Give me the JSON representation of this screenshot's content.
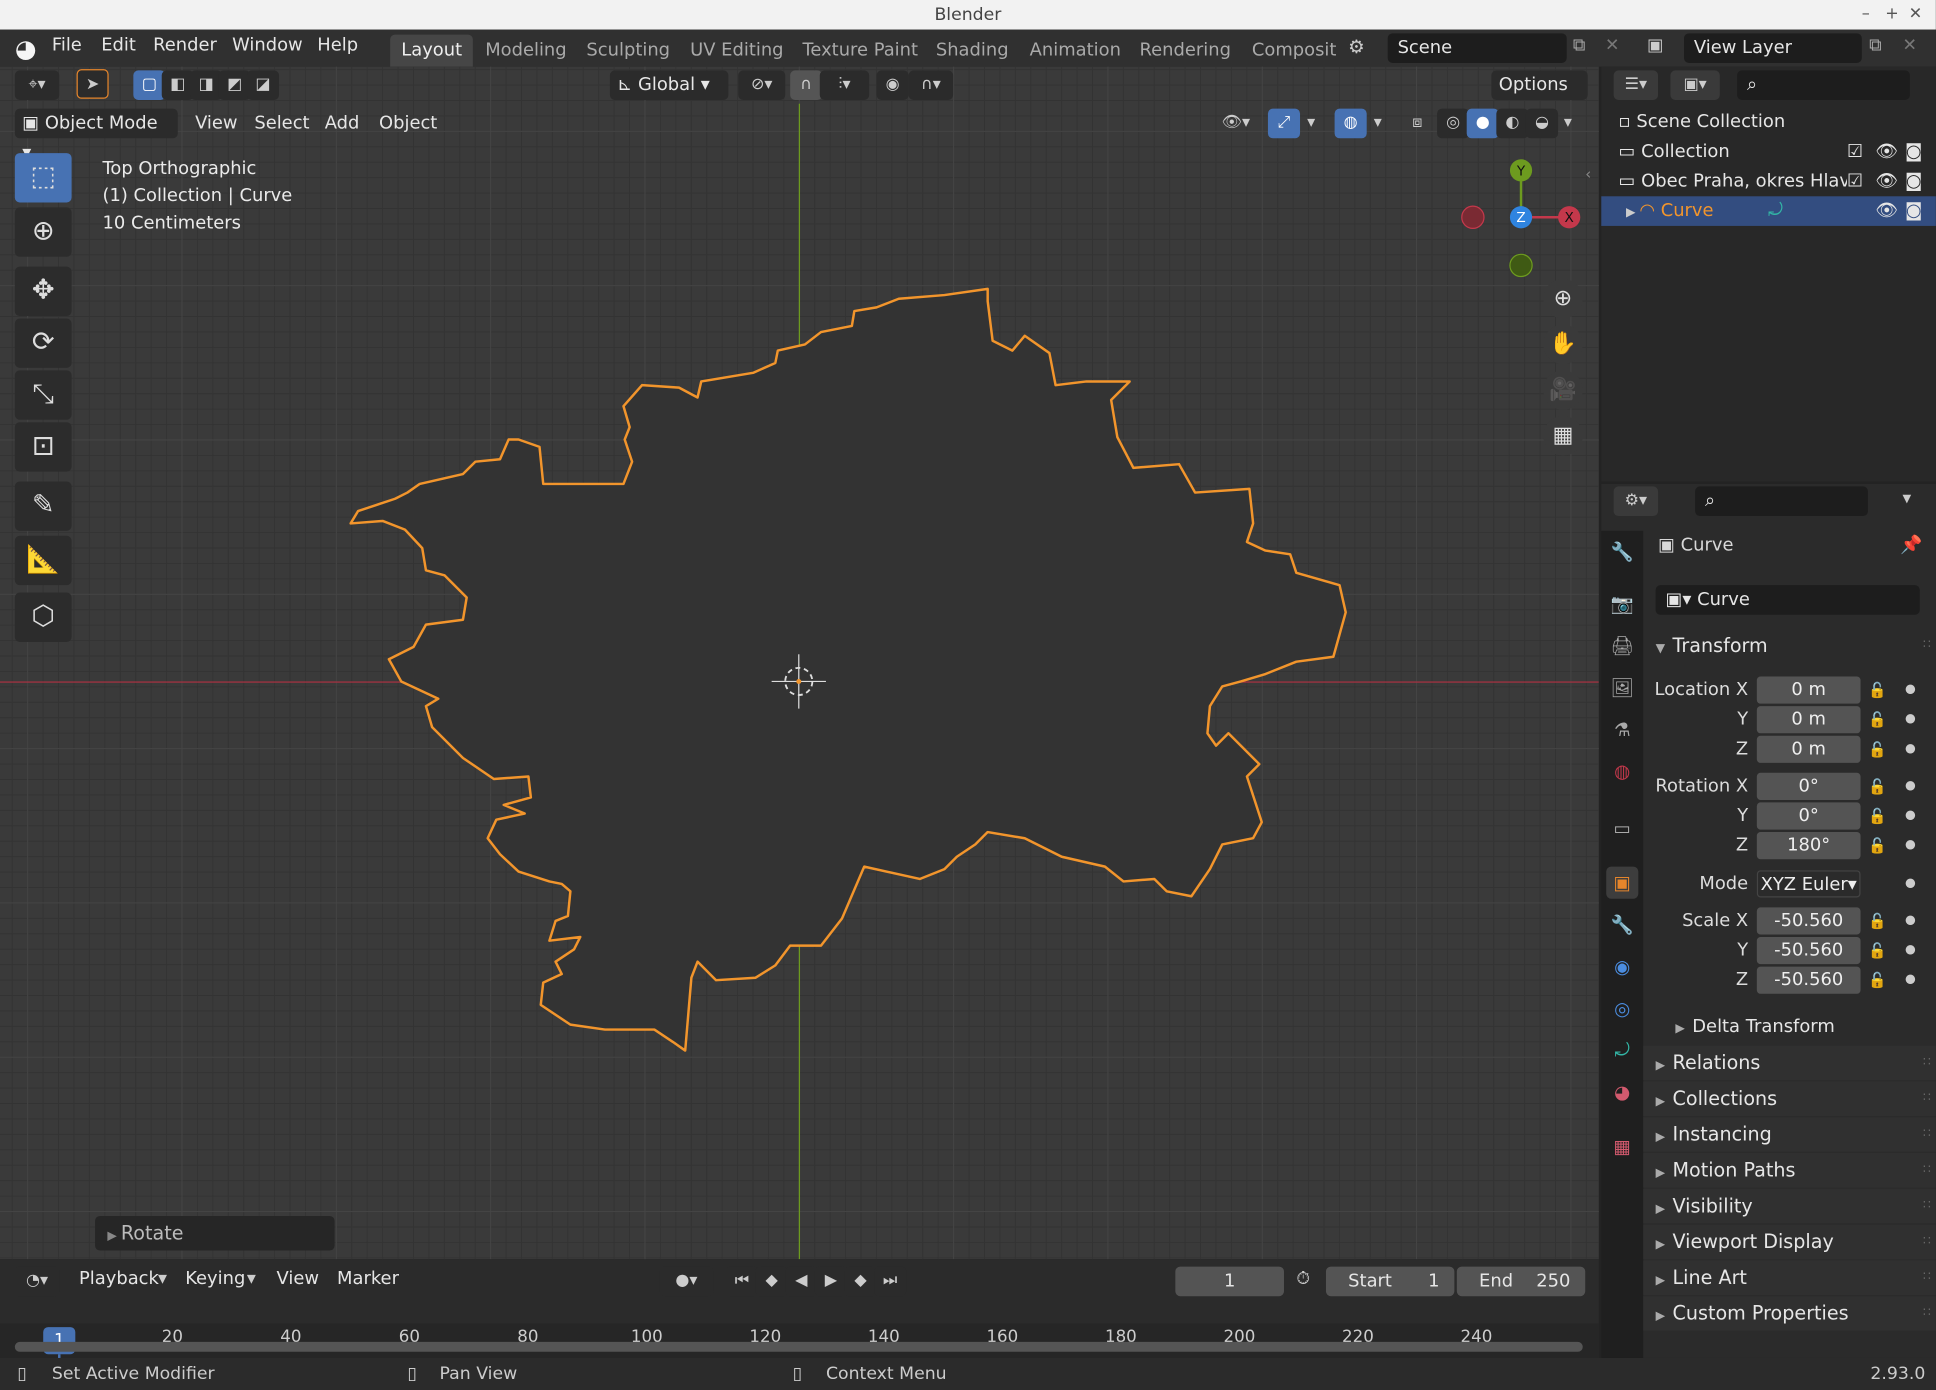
{
  "window": {
    "title": "Blender",
    "controls": [
      "–",
      "+",
      "✕"
    ]
  },
  "menus": [
    "File",
    "Edit",
    "Render",
    "Window",
    "Help"
  ],
  "workspaces": [
    "Layout",
    "Modeling",
    "Sculpting",
    "UV Editing",
    "Texture Paint",
    "Shading",
    "Animation",
    "Rendering",
    "Composit"
  ],
  "scene": {
    "name": "Scene",
    "view_layer": "View Layer"
  },
  "viewport": {
    "mode": "Object Mode",
    "menus": [
      "View",
      "Select",
      "Add",
      "Object"
    ],
    "orientation": "Global",
    "options": "Options",
    "info": [
      "Top Orthographic",
      "(1) Collection | Curve",
      "10 Centimeters"
    ],
    "gizmo_axes": [
      "Y",
      "Z",
      "X"
    ],
    "last_op": "Rotate"
  },
  "timeline": {
    "menus": [
      "Playback",
      "Keying",
      "View",
      "Marker"
    ],
    "current_frame": "1",
    "start_label": "Start",
    "start": "1",
    "end_label": "End",
    "end": "250",
    "ticks": [
      "20",
      "40",
      "60",
      "80",
      "100",
      "120",
      "140",
      "160",
      "180",
      "200",
      "220",
      "240"
    ]
  },
  "outliner": {
    "root": "Scene Collection",
    "items": [
      "Collection",
      "Obec Praha, okres Hlav",
      "Curve"
    ]
  },
  "properties": {
    "object_name": "Curve",
    "data_name": "Curve",
    "section": "Transform",
    "location": {
      "label": "Location X",
      "x": "0 m",
      "y": "0 m",
      "z": "0 m"
    },
    "rotation": {
      "label": "Rotation X",
      "x": "0°",
      "y": "0°",
      "z": "180°"
    },
    "mode_label": "Mode",
    "mode": "XYZ Euler",
    "scale": {
      "label": "Scale X",
      "x": "-50.560",
      "y": "-50.560",
      "z": "-50.560"
    },
    "axis_y": "Y",
    "axis_z": "Z",
    "delta": "Delta Transform",
    "panels": [
      "Relations",
      "Collections",
      "Instancing",
      "Motion Paths",
      "Visibility",
      "Viewport Display",
      "Line Art",
      "Custom Properties"
    ]
  },
  "status": {
    "left": "Set Active Modifier",
    "mid": "Pan View",
    "right": "Context Menu",
    "version": "2.93.0"
  },
  "colors": {
    "selection": "#f2952c",
    "accent": "#4772b3",
    "x_axis": "#c4384b",
    "y_axis": "#6d9b1f",
    "z_axis": "#2f84e0"
  }
}
